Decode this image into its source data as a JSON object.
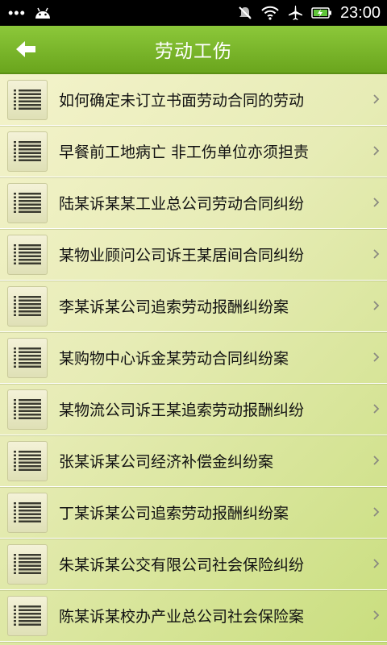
{
  "status_bar": {
    "left_icons": [
      "more-dots-icon",
      "android-icon"
    ],
    "right_icons": [
      "notifications-off-icon",
      "wifi-icon",
      "airplane-icon",
      "battery-icon"
    ],
    "time": "23:00"
  },
  "header": {
    "title": "劳动工伤",
    "back_icon": "back-arrow-icon"
  },
  "list": {
    "items": [
      {
        "label": "如何确定未订立书面劳动合同的劳动"
      },
      {
        "label": "早餐前工地病亡 非工伤单位亦须担责"
      },
      {
        "label": "陆某诉某某工业总公司劳动合同纠纷"
      },
      {
        "label": "某物业顾问公司诉王某居间合同纠纷"
      },
      {
        "label": "李某诉某公司追索劳动报酬纠纷案"
      },
      {
        "label": "某购物中心诉金某劳动合同纠纷案"
      },
      {
        "label": "某物流公司诉王某追索劳动报酬纠纷"
      },
      {
        "label": "张某诉某公司经济补偿金纠纷案"
      },
      {
        "label": "丁某诉某公司追索劳动报酬纠纷案"
      },
      {
        "label": "朱某诉某公交有限公司社会保险纠纷"
      },
      {
        "label": "陈某诉某校办产业总公司社会保险案"
      }
    ]
  },
  "colors": {
    "header_green": "#7ab82c",
    "background": "#e7ecb6"
  }
}
